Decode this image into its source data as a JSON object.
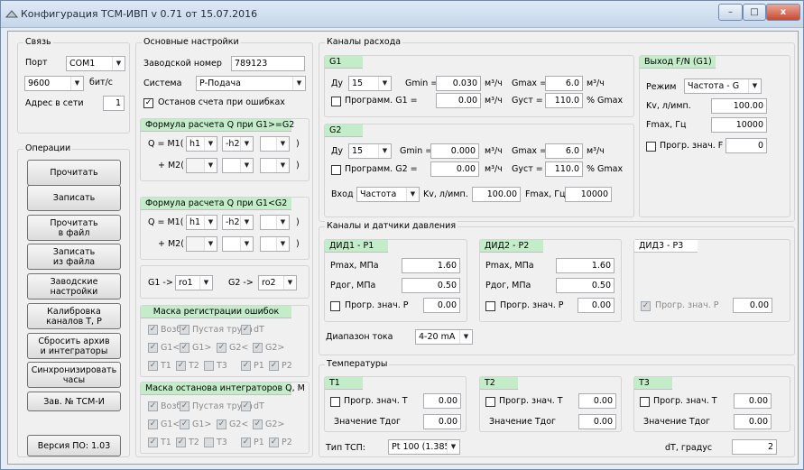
{
  "app": {
    "title": "Конфигурация ТСМ-ИВП v 0.71 от 15.07.2016",
    "window_buttons": {
      "min": "–",
      "max": "□",
      "close": "x"
    }
  },
  "comm": {
    "legend": "Связь",
    "port_label": "Порт",
    "port": "COM1",
    "baud": "9600",
    "baud_unit": "бит/с",
    "addr_label": "Адрес в сети",
    "addr": "1"
  },
  "ops": {
    "legend": "Операции",
    "buttons": [
      "Прочитать",
      "Записать",
      "Прочитать\nв файл",
      "Записать\nиз файла",
      "Заводские\nнастройки",
      "Калибровка\nканалов T, P",
      "Сбросить архив\nи интеграторы",
      "Синхронизировать\nчасы",
      "Зав. № ТСМ-И"
    ],
    "version_btn": "Версия ПО: 1.03"
  },
  "main": {
    "legend": "Основные настройки",
    "serial_label": "Заводской номер",
    "serial": "789123",
    "system_label": "Система",
    "system": "Р-Подача",
    "stop_label": "Останов счета при ошибках",
    "stop_mark": "✓"
  },
  "formula1": {
    "title": "Формула расчета Q при G1>=G2",
    "q_label": "Q = M1(",
    "m2_label": "+ M2(",
    "r1": [
      "h1",
      "-h2",
      ""
    ],
    "r2": [
      "",
      "",
      ""
    ],
    "close": ")"
  },
  "formula2": {
    "title": "Формула расчета Q при G1<G2",
    "q_label": "Q = M1(",
    "m2_label": "+ M2(",
    "r1": [
      "h1",
      "-h2",
      ""
    ],
    "r2": [
      "",
      "",
      ""
    ],
    "close": ")"
  },
  "map": {
    "g1_label": "G1 ->",
    "g1": "ro1",
    "g2_label": "G2 ->",
    "g2": "ro2"
  },
  "errmask": {
    "title": "Маска регистрации ошибок",
    "items": [
      [
        "Возб.",
        "Пустая труба",
        "dT"
      ],
      [
        "G1<",
        "G1>",
        "G2<",
        "G2>"
      ],
      [
        "T1",
        "T2",
        "T3",
        "P1",
        "P2"
      ]
    ]
  },
  "stopmask": {
    "title": "Маска останова интеграторов Q, M",
    "items": [
      [
        "Возб.",
        "Пустая труба",
        "dT"
      ],
      [
        "G1<",
        "G1>",
        "G2<",
        "G2>"
      ],
      [
        "T1",
        "T2",
        "T3",
        "P1",
        "P2"
      ]
    ]
  },
  "flow": {
    "legend": "Каналы расхода",
    "g1": {
      "title": "G1",
      "du_label": "Ду",
      "du": "15",
      "gmin_label": "Gmin =",
      "gmin": "0.030",
      "gmax_label": "Gmax =",
      "gmax": "6.0",
      "unit": "м³/ч",
      "prog_label": "Программ. G1 =",
      "prog": "0.00",
      "gust_label": "Gуст =",
      "gust": "110.0",
      "pct": "% Gmax"
    },
    "g2": {
      "title": "G2",
      "du_label": "Ду",
      "du": "15",
      "gmin_label": "Gmin =",
      "gmin": "0.000",
      "gmax_label": "Gmax =",
      "gmax": "6.0",
      "unit": "м³/ч",
      "prog_label": "Программ. G2 =",
      "prog": "0.00",
      "gust_label": "Gуст =",
      "gust": "110.0",
      "pct": "% Gmax",
      "in_label": "Вход",
      "in": "Частота",
      "kv_label": "Kv, л/имп.",
      "kv": "100.00",
      "fmax_label": "Fmax, Гц",
      "fmax": "10000"
    }
  },
  "fn": {
    "title": "Выход F/N (G1)",
    "mode_label": "Режим",
    "mode": "Частота - G",
    "kv_label": "Kv, л/имп.",
    "kv": "100.00",
    "fmax_label": "Fmax, Гц",
    "fmax": "10000",
    "prog_label": "Прогр. знач. F",
    "prog": "0"
  },
  "pressure": {
    "legend": "Каналы и датчики давления",
    "p1": {
      "title": "ДИД1 - Р1",
      "pmax_label": "Pmax, МПа",
      "pmax": "1.60",
      "pdog_label": "Pдог, МПа",
      "pdog": "0.50",
      "prog_label": "Прогр. знач. P",
      "prog": "0.00"
    },
    "p2": {
      "title": "ДИД2 - Р2",
      "pmax_label": "Pmax, МПа",
      "pmax": "1.60",
      "pdog_label": "Pдог, МПа",
      "pdog": "0.50",
      "prog_label": "Прогр. знач. P",
      "prog": "0.00"
    },
    "p3": {
      "title": "ДИД3 - Р3",
      "prog_label": "Прогр. знач. P",
      "prog": "0.00"
    },
    "range_label": "Диапазон тока",
    "range": "4-20 mA"
  },
  "temp": {
    "legend": "Температуры",
    "t1": {
      "title": "T1",
      "prog_label": "Прогр. знач. T",
      "prog": "0.00",
      "dog_label": "Значение Tдог",
      "dog": "0.00"
    },
    "t2": {
      "title": "T2",
      "prog_label": "Прогр. знач. T",
      "prog": "0.00",
      "dog_label": "Значение Tдог",
      "dog": "0.00"
    },
    "t3": {
      "title": "T3",
      "prog_label": "Прогр. знач. T",
      "prog": "0.00",
      "dog_label": "Значение Tдог",
      "dog": "0.00"
    },
    "tsp_label": "Тип ТСП:",
    "tsp": "Pt 100 (1.385",
    "dt_label": "dT, градус",
    "dt": "2"
  }
}
